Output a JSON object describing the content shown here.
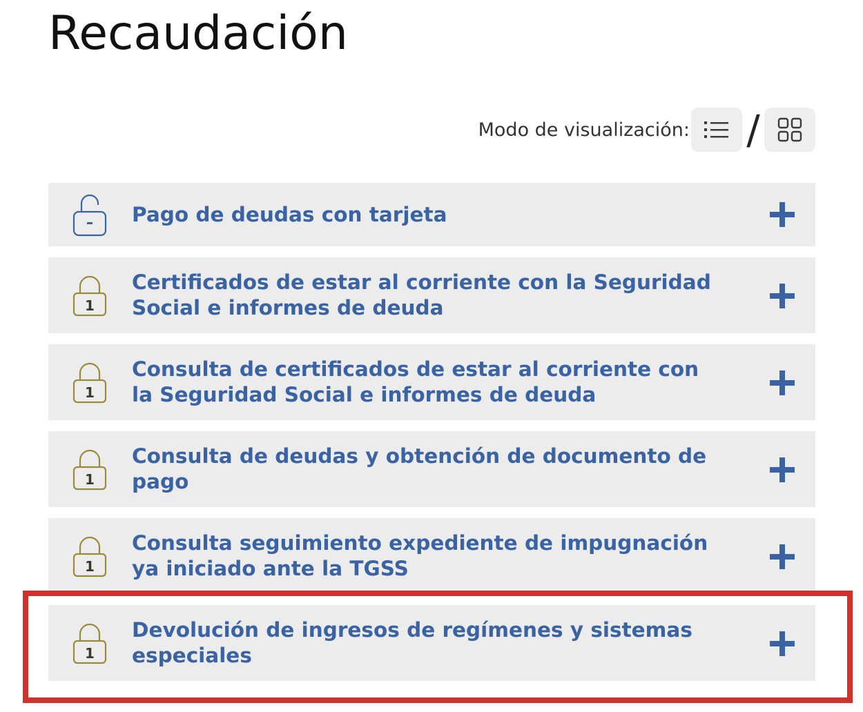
{
  "page": {
    "title": "Recaudación"
  },
  "view_mode": {
    "label": "Modo de visualización:",
    "separator": "/",
    "list_icon": "list-icon",
    "grid_icon": "grid-icon"
  },
  "colors": {
    "link_blue": "#3a63a3",
    "lock_gold": "#9a8a3a",
    "lock_blue": "#3a63a3",
    "item_bg": "#ececec",
    "highlight_red": "#d2322b"
  },
  "services": [
    {
      "label": "Pago de deudas con tarjeta",
      "lock_icon": "unlocked-padlock-icon",
      "lock_level": ""
    },
    {
      "label": "Certificados de estar al corriente con la Seguridad Social e informes de deuda",
      "lock_icon": "padlock-level-1-icon",
      "lock_level": "1"
    },
    {
      "label": "Consulta de certificados de estar al corriente con la Seguridad Social e informes de deuda",
      "lock_icon": "padlock-level-1-icon",
      "lock_level": "1"
    },
    {
      "label": "Consulta de deudas y obtención de documento de pago",
      "lock_icon": "padlock-level-1-icon",
      "lock_level": "1"
    },
    {
      "label": "Consulta seguimiento expediente de impugnación ya iniciado ante la TGSS",
      "lock_icon": "padlock-level-1-icon",
      "lock_level": "1"
    },
    {
      "label": "Devolución de ingresos de regímenes y sistemas especiales",
      "lock_icon": "padlock-level-1-icon",
      "lock_level": "1",
      "highlighted": true
    }
  ]
}
